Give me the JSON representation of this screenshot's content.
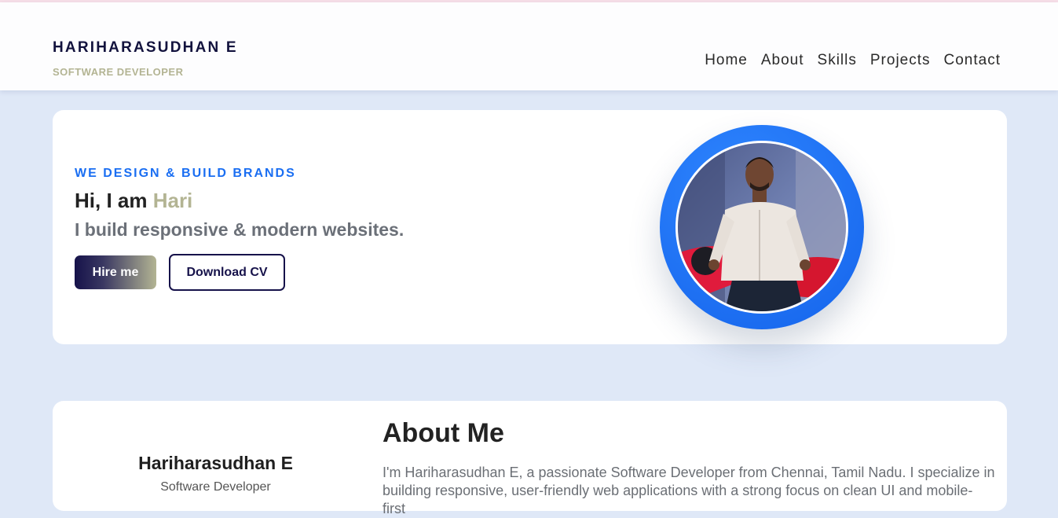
{
  "header": {
    "brand_name": "HARIHARASUDHAN E",
    "brand_role": "SOFTWARE DEVELOPER",
    "nav": [
      "Home",
      "About",
      "Skills",
      "Projects",
      "Contact"
    ]
  },
  "hero": {
    "tag": "WE DESIGN & BUILD BRANDS",
    "greeting_prefix": "Hi, I am ",
    "name_accent": "Hari",
    "subtitle": "I build responsive & modern websites.",
    "hire_label": "Hire me",
    "cv_label": "Download CV"
  },
  "about": {
    "left_name": "Hariharasudhan E",
    "left_role": "Software Developer",
    "title": "About Me",
    "text": "I'm Hariharasudhan E, a passionate Software Developer from Chennai, Tamil Nadu. I specialize in building responsive, user-friendly web applications with a strong focus on clean UI and mobile-first"
  },
  "colors": {
    "page_bg": "#dfe8f7",
    "brand_dark": "#12123d",
    "accent_olive": "#b3b493",
    "accent_blue": "#1a6ef2"
  },
  "icons": [
    "profile-photo"
  ]
}
